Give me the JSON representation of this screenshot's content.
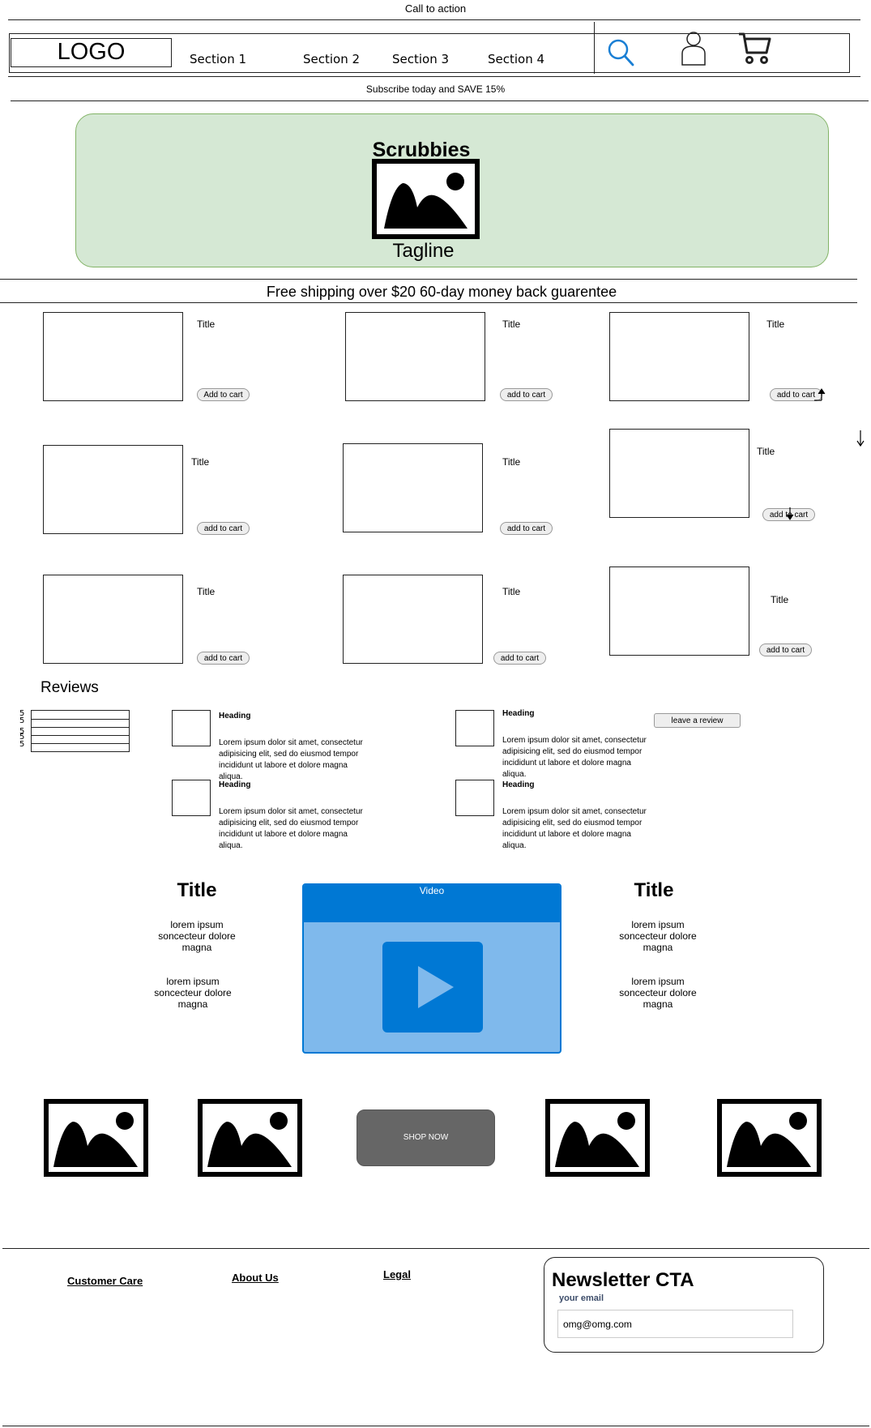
{
  "header": {
    "call_to_action": "Call to action",
    "logo": "LOGO",
    "nav": [
      "Section 1",
      "Section 2",
      "Section 3",
      "Section 4"
    ],
    "icons": [
      "search-icon",
      "user-icon",
      "cart-icon"
    ],
    "subscribe": "Subscribe today and SAVE 15%"
  },
  "hero": {
    "title": "Scrubbies",
    "tagline": "Tagline",
    "background": "#d5e8d4",
    "border": "#82b366"
  },
  "shipping_banner": "Free shipping over $20 60-day money back guarentee",
  "products": [
    {
      "title": "Title",
      "button": "Add to cart"
    },
    {
      "title": "Title",
      "button": "add to cart"
    },
    {
      "title": "Title",
      "button": "add to cart"
    },
    {
      "title": "Title",
      "button": "add to cart"
    },
    {
      "title": "Title",
      "button": "add to cart"
    },
    {
      "title": "Title",
      "button": "add to cart"
    },
    {
      "title": "Title",
      "button": "add to cart"
    },
    {
      "title": "Title",
      "button": "add to cart"
    },
    {
      "title": "Title",
      "button": "add to cart"
    }
  ],
  "reviews": {
    "title": "Reviews",
    "ratings": [
      "5",
      "5",
      "5",
      "5",
      "5"
    ],
    "items": [
      {
        "heading": "Heading",
        "body": "Lorem ipsum dolor sit amet, consectetur adipisicing elit, sed do eiusmod tempor incididunt ut labore et dolore magna aliqua."
      },
      {
        "heading": "Heading",
        "body": "Lorem ipsum dolor sit amet, consectetur adipisicing elit, sed do eiusmod tempor incididunt ut labore et dolore magna aliqua."
      },
      {
        "heading": "Heading",
        "body": "Lorem ipsum dolor sit amet, consectetur adipisicing elit, sed do eiusmod tempor incididunt ut labore et dolore magna aliqua."
      },
      {
        "heading": "Heading",
        "body": "Lorem ipsum dolor sit amet, consectetur adipisicing elit, sed do eiusmod tempor incididunt ut labore et dolore magna aliqua."
      }
    ],
    "leave_review": "leave a review"
  },
  "feature": {
    "left_title": "Title",
    "right_title": "Title",
    "lorem": "lorem ipsum soncecteur dolore magna",
    "video_label": "Video",
    "video_color": "#0078d4",
    "video_bg": "#7fb9ec"
  },
  "gallery": {
    "shop_now": "SHOP NOW"
  },
  "footer": {
    "links": [
      "Customer Care",
      "About Us",
      "Legal"
    ],
    "newsletter_title": "Newsletter CTA",
    "email_label": "your email",
    "email_value": "omg@omg.com"
  }
}
